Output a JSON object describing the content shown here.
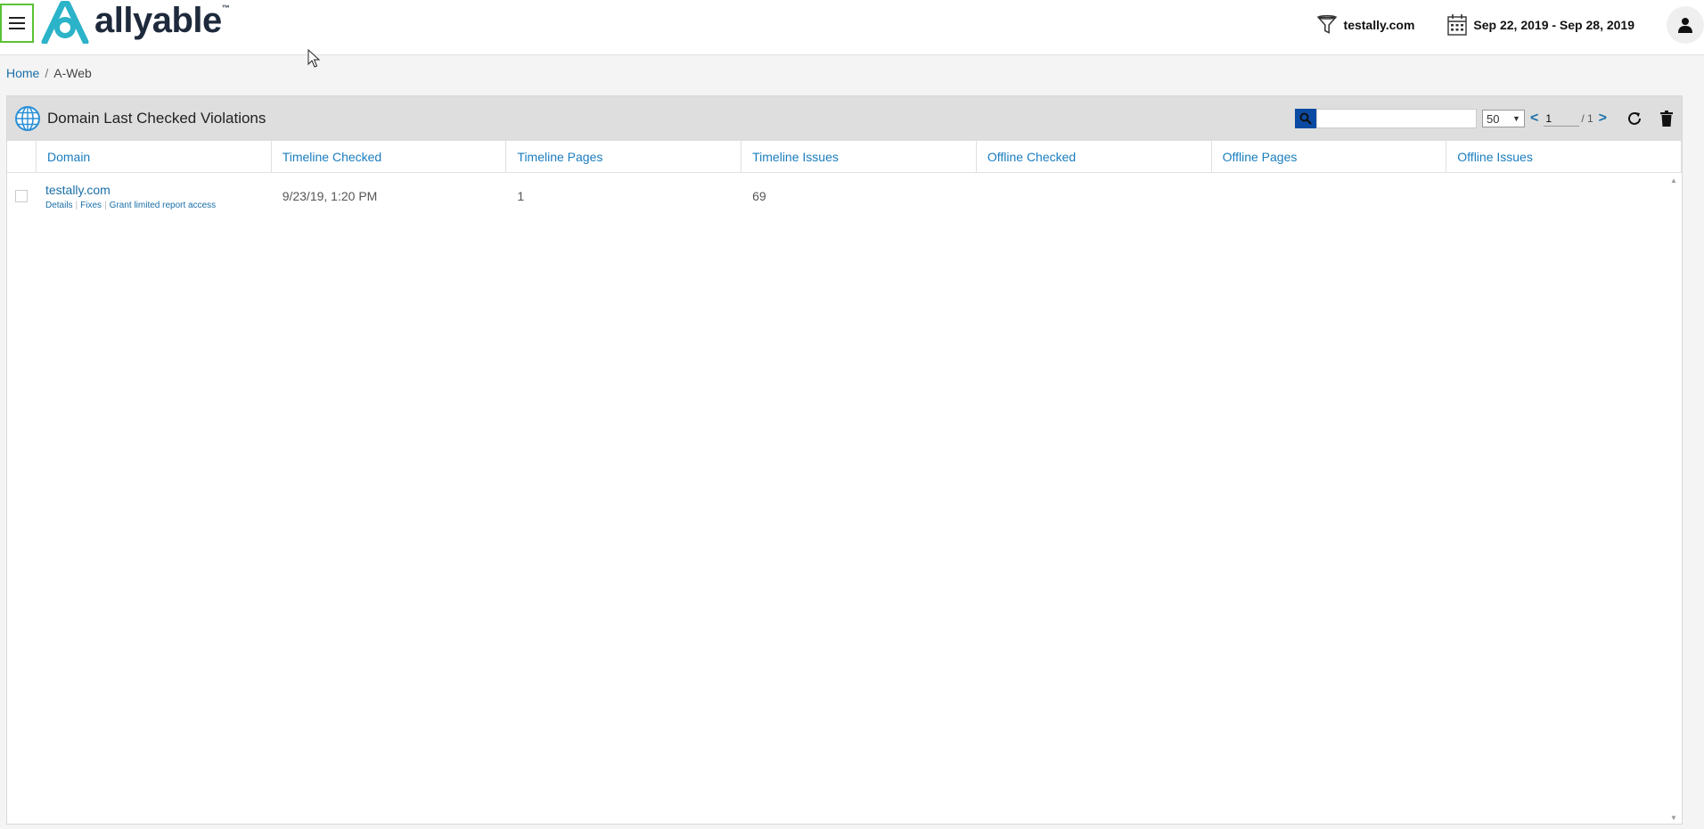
{
  "header": {
    "logo_text": "allyable",
    "logo_tm": "™",
    "filter_domain": "testally.com",
    "date_range": "Sep 22, 2019 - Sep 28, 2019"
  },
  "breadcrumb": {
    "home": "Home",
    "separator": "/",
    "current": "A-Web"
  },
  "panel": {
    "title": "Domain Last Checked Violations",
    "search_placeholder": "",
    "per_page": "50",
    "page_current": "1",
    "page_total": "/ 1",
    "prev": "<",
    "next": ">"
  },
  "table": {
    "columns": [
      "Domain",
      "Timeline Checked",
      "Timeline Pages",
      "Timeline Issues",
      "Offline Checked",
      "Offline Pages",
      "Offline Issues"
    ],
    "rows": [
      {
        "domain": "testally.com",
        "links": [
          "Details",
          "Fixes",
          "Grant limited report access"
        ],
        "timeline_checked": "9/23/19, 1:20 PM",
        "timeline_pages": "1",
        "timeline_issues": "69",
        "offline_checked": "",
        "offline_pages": "",
        "offline_issues": ""
      }
    ]
  },
  "colors": {
    "link": "#1a6fa8",
    "header_accent": "#5bc236",
    "search_button": "#0b4aa2",
    "logo_teal": "#2bb3c9"
  }
}
